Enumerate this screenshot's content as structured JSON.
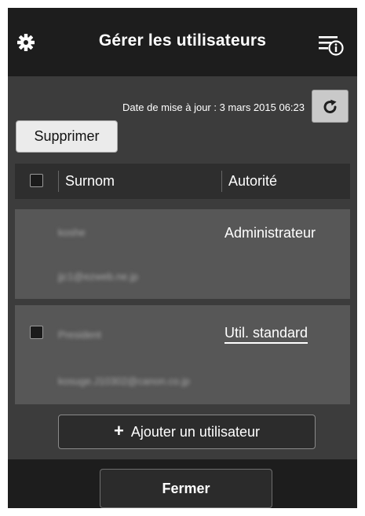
{
  "header": {
    "title": "Gérer les utilisateurs",
    "left_icon": "gear-icon",
    "right_icon": "menu-info-icon"
  },
  "update": {
    "label": "Date de mise à jour : 3 mars 2015 06:23",
    "refresh_icon": "refresh-icon"
  },
  "toolbar": {
    "delete_label": "Supprimer"
  },
  "table": {
    "columns": [
      "Surnom",
      "Autorité"
    ],
    "rows": [
      {
        "nickname": "koshe",
        "email": "jjc1@ezweb.ne.jp",
        "role": "Administrateur",
        "has_checkbox": false,
        "role_link": false
      },
      {
        "nickname": "President",
        "email": "kosuge.J10302@canon.co.jp",
        "role": "Util. standard",
        "has_checkbox": true,
        "role_link": true
      }
    ]
  },
  "add_user": {
    "icon": "plus-icon",
    "label": "Ajouter un utilisateur"
  },
  "footer": {
    "close_label": "Fermer"
  },
  "colors": {
    "bar": "#1d1d1d",
    "background": "#3c3c3c",
    "card": "#575757",
    "header_row": "#2e2e2e",
    "refresh_button": "#c9c9c9"
  }
}
